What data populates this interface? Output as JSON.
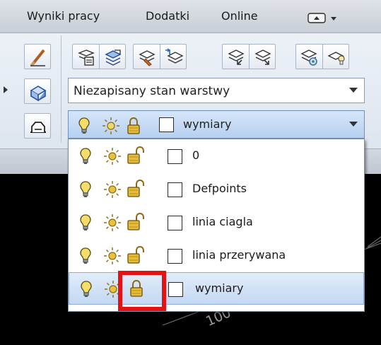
{
  "menubar": {
    "items": [
      "Wyniki pracy",
      "Dodatki",
      "Online"
    ]
  },
  "layer_state": {
    "value": "Niezapisany stan warstwy"
  },
  "current_layer": {
    "name": "wymiary"
  },
  "layers": [
    {
      "name": "0",
      "on": true,
      "frozen": false,
      "locked": false,
      "color": "#ffffff"
    },
    {
      "name": "Defpoints",
      "on": true,
      "frozen": false,
      "locked": false,
      "color": "#ffffff"
    },
    {
      "name": "linia ciagla",
      "on": true,
      "frozen": false,
      "locked": false,
      "color": "#ffffff"
    },
    {
      "name": "linia przerywana",
      "on": true,
      "frozen": false,
      "locked": false,
      "color": "#ffffff"
    },
    {
      "name": "wymiary",
      "on": true,
      "frozen": false,
      "locked": true,
      "color": "#ffffff",
      "selected": true
    }
  ],
  "highlight": {
    "target": "lock-icon of layer wymiary",
    "color": "#e41213"
  },
  "canvas": {
    "dimension_text": "100"
  },
  "icons": {
    "left_column": [
      "match-layer-brush-icon",
      "layer-properties-3d-icon",
      "layer-isolate-icon"
    ],
    "top_toolbar": [
      "layer-properties-icon",
      "layer-states-icon",
      "make-current-icon",
      "layer-match-icon",
      "layer-previous-icon",
      "layer-walk-icon",
      "layer-settings-icon",
      "layer-freeze-icon"
    ],
    "row": [
      "lightbulb-on-icon",
      "sun-thawed-icon",
      "lock-icon",
      "color-swatch"
    ]
  },
  "colors": {
    "bulb": "#f3dd6b",
    "sun": "#e9c13d",
    "lock_gold": "#e5bd3a",
    "selection_blue": "#c3d8f2",
    "accent_red": "#e41213"
  }
}
